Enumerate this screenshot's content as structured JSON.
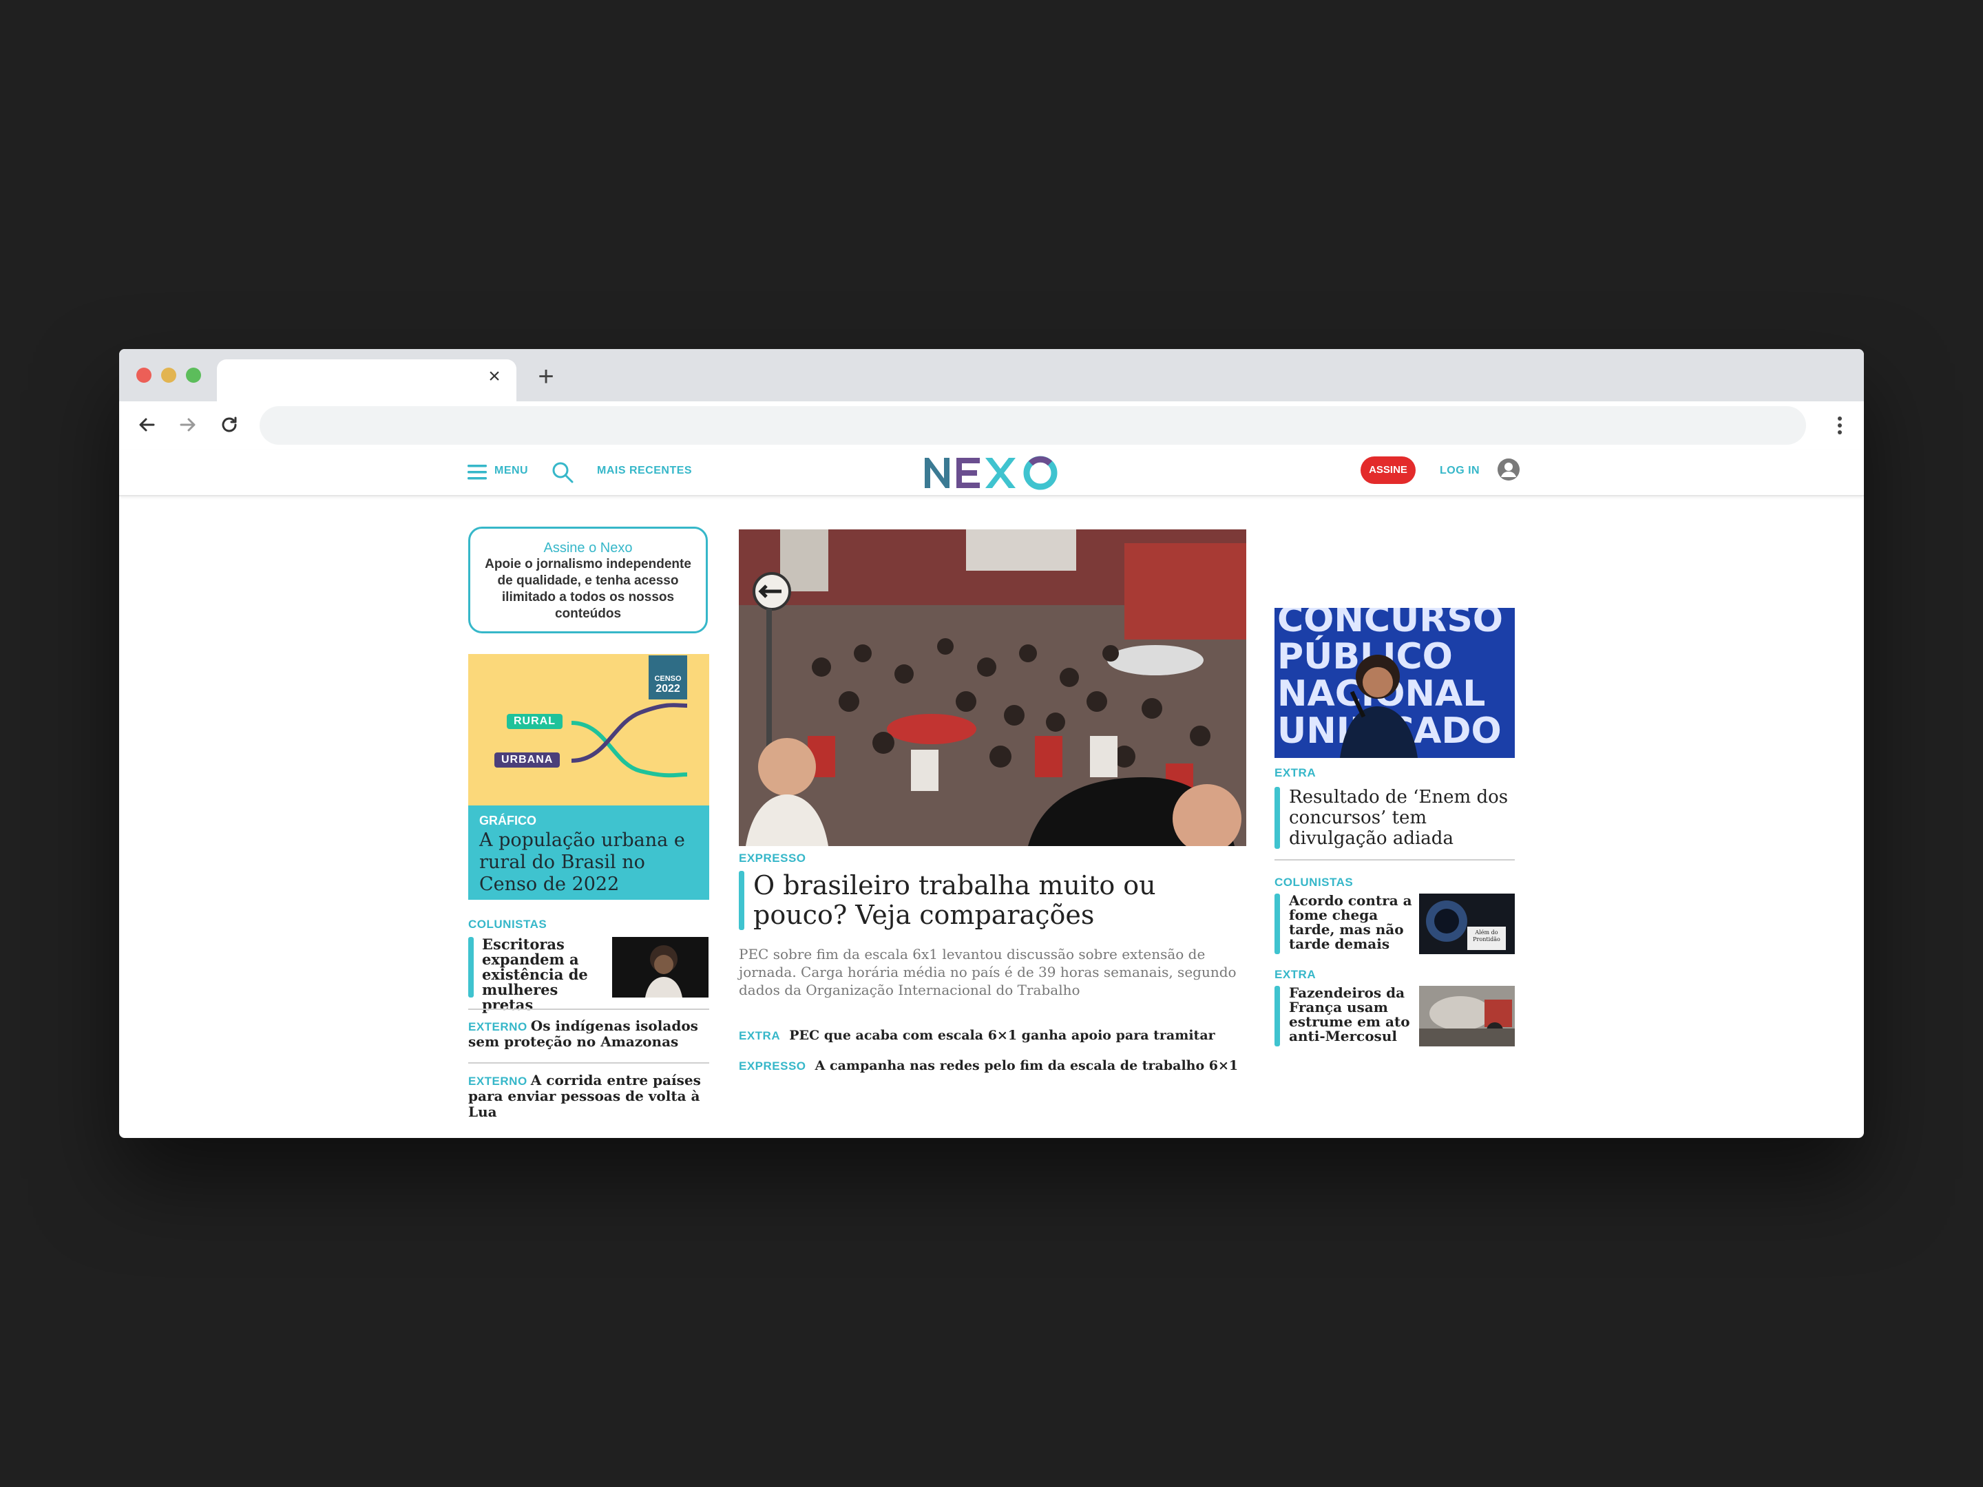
{
  "browser": {
    "tab_title": "",
    "tab_close": "×",
    "new_tab": "+",
    "address": ""
  },
  "header": {
    "menu_label": "MENU",
    "recent_label": "MAIS RECENTES",
    "logo": "NEXO",
    "subscribe_label": "ASSINE",
    "login_label": "LOG IN"
  },
  "left": {
    "subscribe_box": {
      "title": "Assine o Nexo",
      "text": "Apoie o jornalismo independente de qualidade, e tenha acesso ilimitado a todos os nossos conteúdos"
    },
    "census_graphic": {
      "badge_top": "CENSO",
      "badge_year": "2022",
      "rural": "RURAL",
      "urbana": "URBANA"
    },
    "census_card": {
      "label": "GRÁFICO",
      "headline": "A população urbana e rural do Brasil no Censo de 2022"
    },
    "columnists": {
      "label": "COLUNISTAS",
      "headline": "Escritoras expandem a existência de mulheres pretas"
    },
    "items": [
      {
        "label": "EXTERNO",
        "headline": "Os indígenas isolados sem proteção no Amazonas"
      },
      {
        "label": "EXTERNO",
        "headline": "A corrida entre países para enviar pessoas de volta à Lua"
      }
    ]
  },
  "center": {
    "label": "EXPRESSO",
    "headline": "O brasileiro trabalha muito ou pouco? Veja comparações",
    "summary": "PEC sobre fim da escala 6x1 levantou discussão sobre extensão de jornada. Carga horária média no país é de 39 horas semanais, segundo dados da Organização Internacional do Trabalho",
    "related": [
      {
        "label": "EXTRA",
        "headline": "PEC que acaba com escala 6×1 ganha apoio para tramitar"
      },
      {
        "label": "EXPRESSO",
        "headline": "A campanha nas redes pelo fim da escala de trabalho 6×1"
      }
    ]
  },
  "right": {
    "top_image_text": [
      "CONCURSO",
      "PÚBLICO",
      "NACIONAL",
      "UNIFICADO"
    ],
    "top": {
      "label": "EXTRA",
      "headline": "Resultado de ‘Enem dos concursos’ tem divulgação adiada"
    },
    "columnists": {
      "label": "COLUNISTAS",
      "headline": "Acordo contra a fome chega tarde, mas não tarde demais",
      "thumb_caption": "Além do Prontidão"
    },
    "extra": {
      "label": "EXTRA",
      "headline": "Fazendeiros da França usam estrume em ato anti-Mercosul"
    }
  },
  "colors": {
    "accent": "#36b7c9",
    "subscribe_red": "#e32b2b",
    "census_yellow": "#fbd87a",
    "census_cyan": "#3fc3cf"
  }
}
